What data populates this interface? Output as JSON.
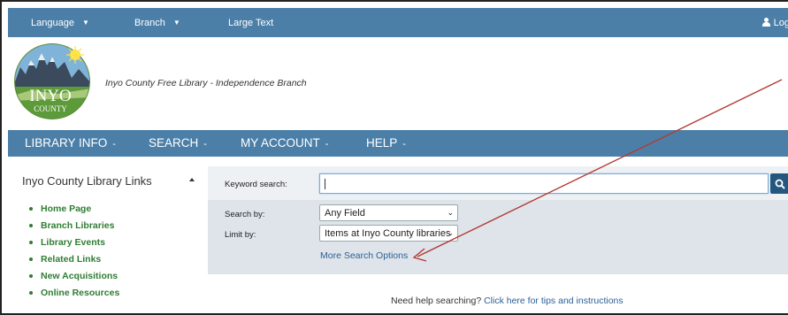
{
  "topbar": {
    "language": "Language",
    "branch": "Branch",
    "large_text": "Large Text",
    "login": "Log"
  },
  "header": {
    "logo_text": "INYO",
    "logo_subtext": "COUNTY",
    "library_name": "Inyo County Free Library - Independence Branch"
  },
  "nav": {
    "items": [
      {
        "label": "LIBRARY INFO"
      },
      {
        "label": "SEARCH"
      },
      {
        "label": "MY ACCOUNT"
      },
      {
        "label": "HELP"
      }
    ]
  },
  "sidebar": {
    "title": "Inyo County Library Links",
    "links": [
      {
        "label": "Home Page"
      },
      {
        "label": "Branch Libraries"
      },
      {
        "label": "Library Events"
      },
      {
        "label": "Related Links"
      },
      {
        "label": "New Acquisitions"
      },
      {
        "label": "Online Resources"
      }
    ]
  },
  "search": {
    "keyword_label": "Keyword search:",
    "keyword_value": "",
    "search_by_label": "Search by:",
    "search_by_value": "Any Field",
    "limit_by_label": "Limit by:",
    "limit_by_value": "Items at Inyo County libraries",
    "more_options": "More Search Options"
  },
  "help": {
    "prefix": "Need help searching?",
    "link": "Click here for tips and instructions"
  },
  "colors": {
    "nav_blue": "#4c7fa8",
    "link_green": "#2e7d32",
    "link_blue": "#2c5f96",
    "annotation_red": "#b23a32"
  }
}
